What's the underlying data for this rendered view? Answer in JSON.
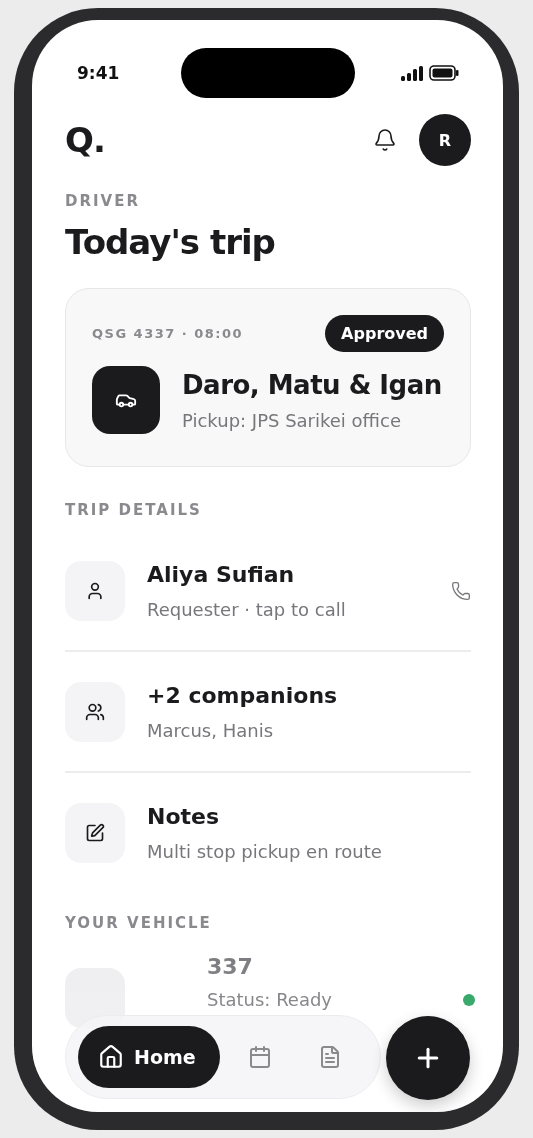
{
  "status_bar": {
    "time": "9:41"
  },
  "header": {
    "logo": "Q.",
    "avatar": "R"
  },
  "role_label": "DRIVER",
  "title": "Today's trip",
  "trip_card": {
    "code": "QSG 4337 · 08:00",
    "status": "Approved",
    "passengers": "Daro, Matu & Igan",
    "pickup": "Pickup: JPS Sarikei office"
  },
  "trip_details": {
    "heading": "TRIP DETAILS",
    "items": [
      {
        "kind": "person",
        "title": "Aliya Sufian",
        "subtitle": "Requester · tap to call",
        "callable": true
      },
      {
        "kind": "group",
        "title": "+2 companions",
        "subtitle": "Marcus, Hanis",
        "callable": false
      },
      {
        "kind": "note",
        "title": "Notes",
        "subtitle": "Multi stop pickup en route",
        "callable": false
      }
    ]
  },
  "vehicle": {
    "heading": "YOUR VEHICLE",
    "plate": "337",
    "status": "Status: Ready"
  },
  "nav": {
    "items": [
      {
        "kind": "home",
        "label": "Home",
        "selected": true
      },
      {
        "kind": "calendar",
        "selected": false
      },
      {
        "kind": "document",
        "selected": false
      }
    ]
  }
}
